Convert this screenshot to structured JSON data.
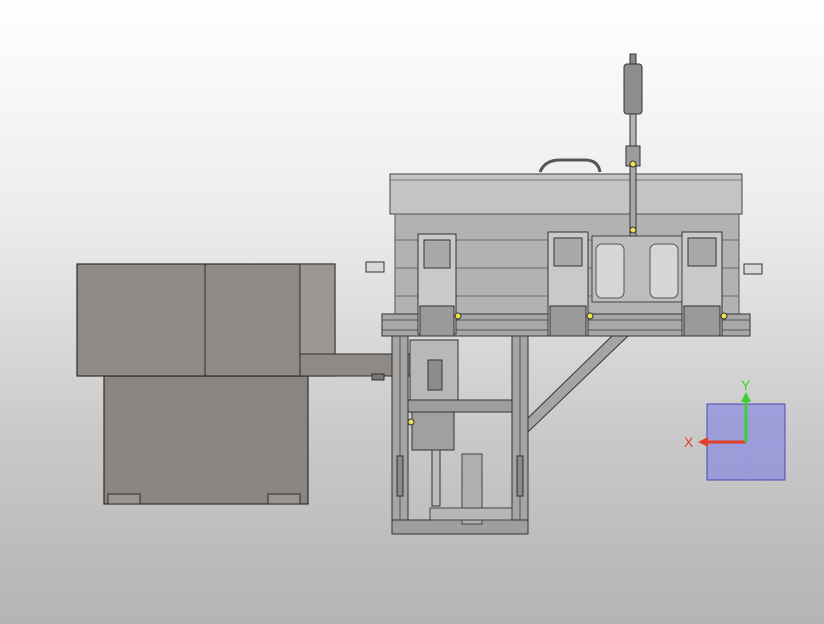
{
  "viewport": {
    "background_top": "#ffffff",
    "background_bottom": "#b4b4b4"
  },
  "model": {
    "body_color": "#8c8782",
    "body_edge": "#3a3835",
    "frame_color": "#b9b9b9",
    "frame_dark": "#6f6f6f",
    "accent_yellow": "#e8e34a"
  },
  "triad": {
    "x_label": "X",
    "y_label": "Y",
    "x_color": "#e0402a",
    "y_color": "#3fcf33",
    "z_color": "#6a6fe0",
    "box_color": "#7878e8"
  }
}
